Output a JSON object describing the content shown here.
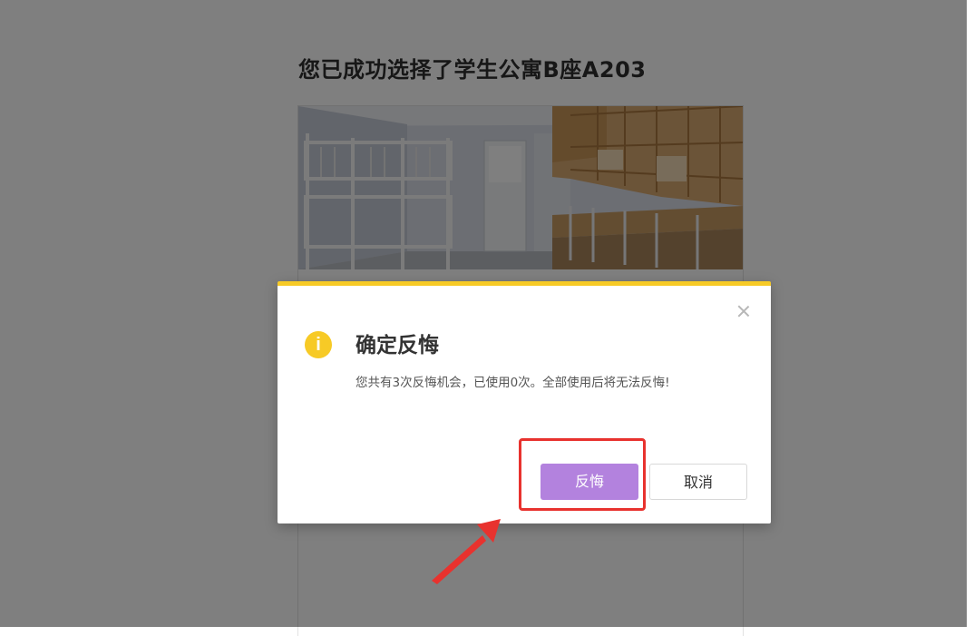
{
  "page": {
    "title": "您已成功选择了学生公寓B座A203"
  },
  "dialog": {
    "icon": "info-icon",
    "icon_glyph": "i",
    "title": "确定反悔",
    "message": "您共有3次反悔机会，已使用0次。全部使用后将无法反悔!",
    "confirm_label": "反悔",
    "cancel_label": "取消",
    "accent_color": "#f7ca26",
    "confirm_color": "#b382de"
  },
  "annotation": {
    "highlight_color": "#e8322e"
  }
}
